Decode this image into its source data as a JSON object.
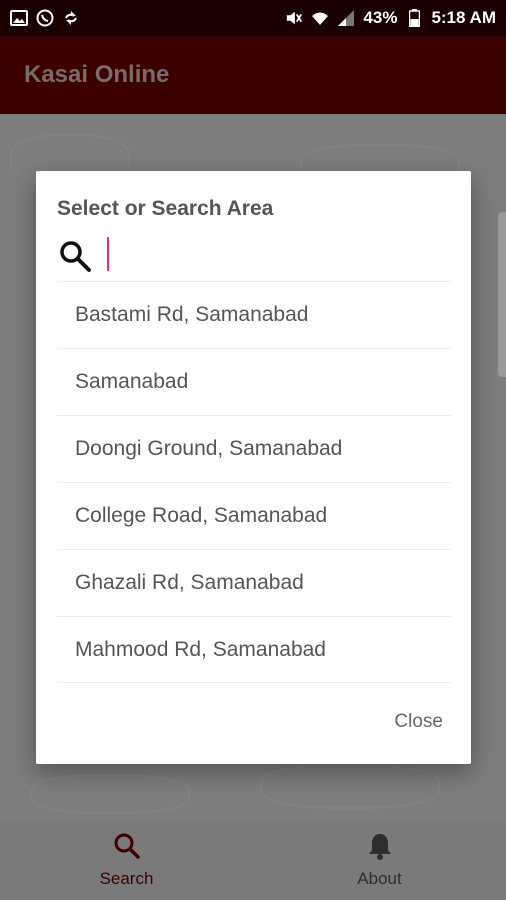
{
  "status_bar": {
    "battery": "43%",
    "time": "5:18 AM",
    "left_icons": [
      "gallery-icon",
      "whatsapp-icon",
      "sync-icon"
    ],
    "right_icons": [
      "mute-icon",
      "wifi-icon",
      "signal-icon",
      "battery-icon"
    ]
  },
  "app_bar": {
    "title": "Kasai Online"
  },
  "dialog": {
    "title": "Select or Search Area",
    "search": {
      "placeholder": "",
      "value": ""
    },
    "items": [
      "Bastami Rd, Samanabad",
      "Samanabad",
      "Doongi Ground, Samanabad",
      "College Road, Samanabad",
      "Ghazali Rd, Samanabad",
      "Mahmood Rd, Samanabad"
    ],
    "close_label": "Close"
  },
  "bottom_nav": {
    "search_label": "Search",
    "about_label": "About"
  },
  "colors": {
    "status_bar": "#1a0000",
    "app_bar": "#3d0000",
    "accent_caret": "#e0336a"
  }
}
